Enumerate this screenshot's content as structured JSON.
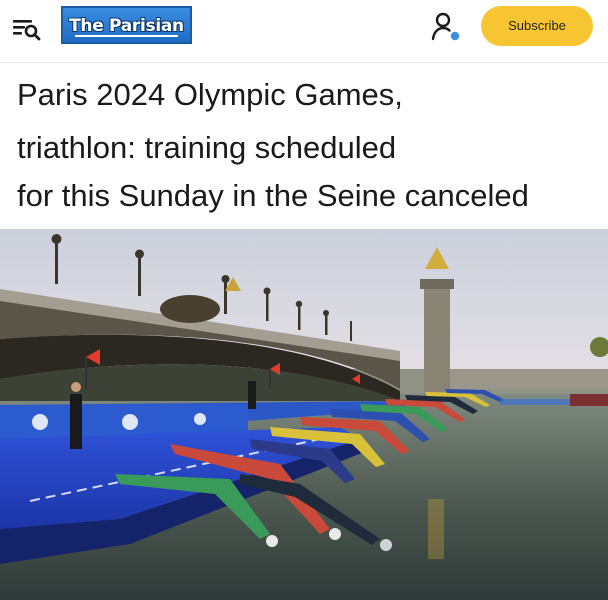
{
  "header": {
    "logo_text": "The Parisian",
    "subscribe_label": "Subscribe",
    "menu_icon": "menu-search-icon",
    "account_icon": "user-icon"
  },
  "article": {
    "title_lines": [
      "Paris 2024 Olympic Games,",
      "triathlon: training scheduled",
      "for this Sunday in the Seine canceled"
    ]
  },
  "colors": {
    "accent": "#f7c531",
    "logo_blue": "#2a7bd6",
    "notification_dot": "#3a8fe0"
  }
}
